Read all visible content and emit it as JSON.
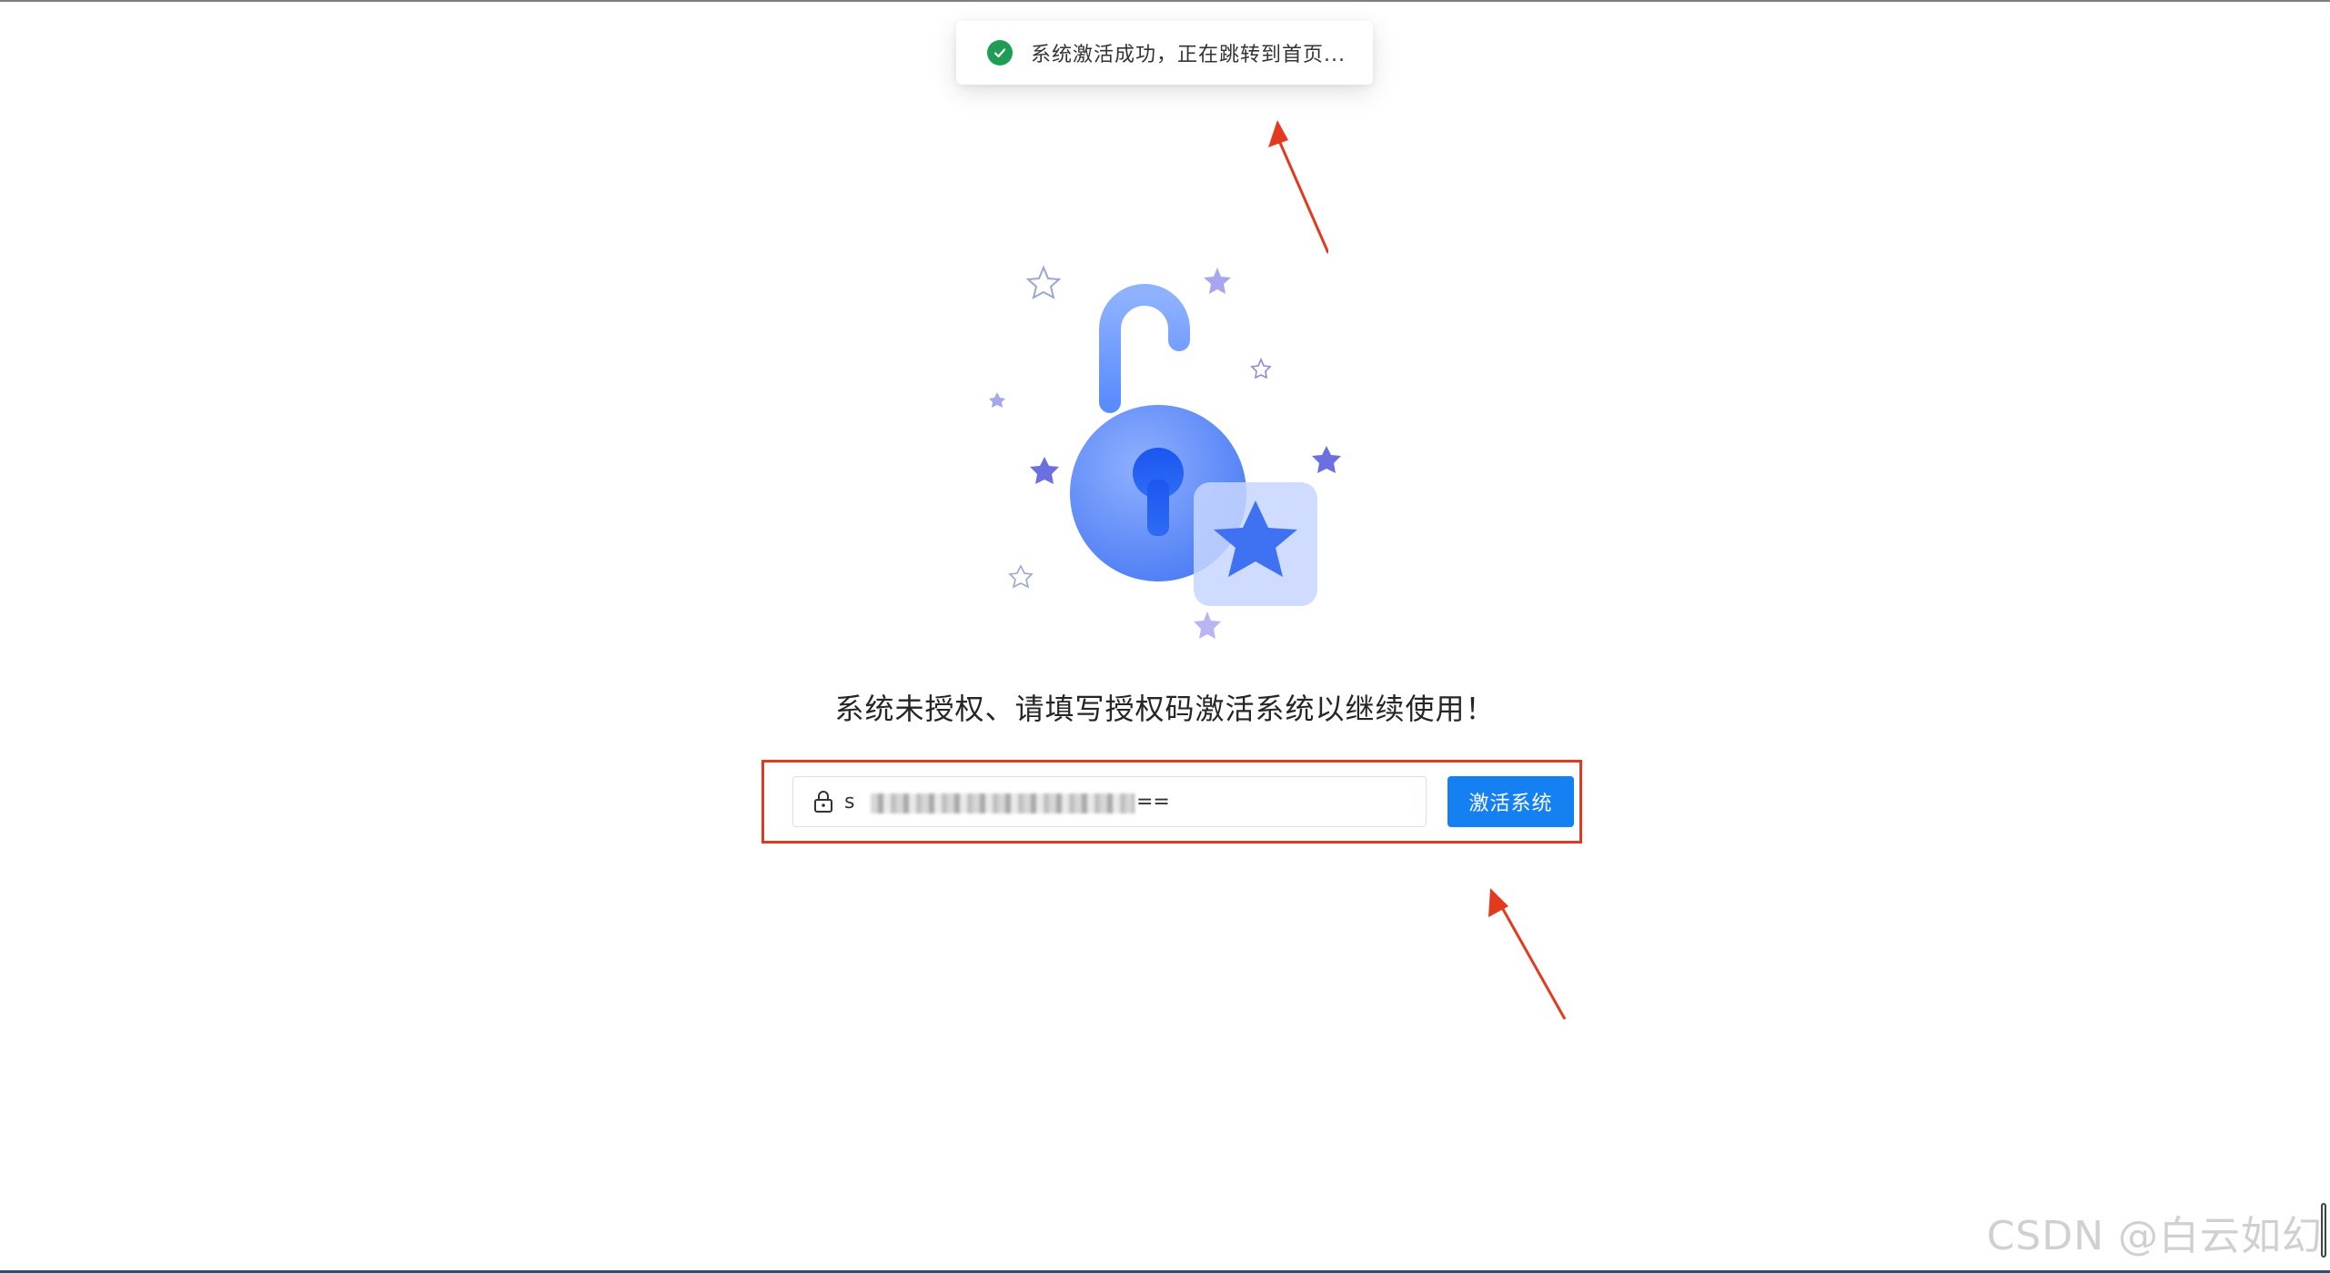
{
  "toast": {
    "icon": "check-circle-icon",
    "message": "系统激活成功，正在跳转到首页..."
  },
  "illustration": {
    "name": "unlocked-padlock-illustration",
    "colors": {
      "primary": "#5b8cff",
      "accent": "#7b7ff0",
      "star_light": "#b8b5f2"
    }
  },
  "tip": "系统未授权、请填写授权码激活系统以继续使用！",
  "form": {
    "lock_icon": "lock-icon",
    "code_value": "s",
    "code_suffix": "==",
    "activate_label": "激活系统",
    "highlight_color": "#e33a1f"
  },
  "annotations": {
    "arrow_color": "#e33a1f"
  },
  "watermark": "CSDN @白云如幻"
}
